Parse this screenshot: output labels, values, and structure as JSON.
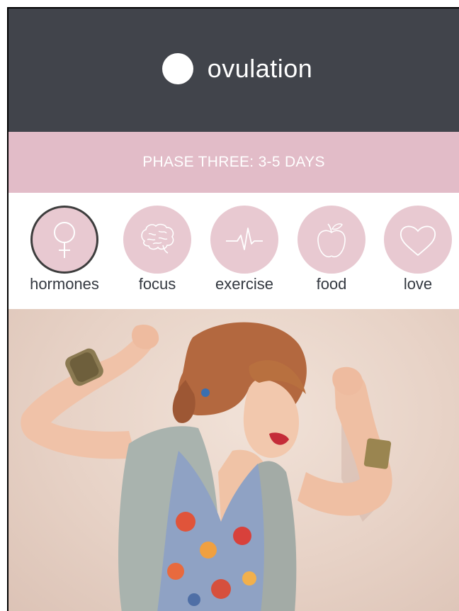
{
  "header": {
    "title": "ovulation",
    "accent": "#41444b"
  },
  "phase": {
    "label": "PHASE THREE: 3-5 DAYS",
    "color": "#e2bcc8"
  },
  "categories": [
    {
      "label": "hormones",
      "icon": "female-symbol-icon",
      "selected": true
    },
    {
      "label": "focus",
      "icon": "brain-icon",
      "selected": false
    },
    {
      "label": "exercise",
      "icon": "heartbeat-icon",
      "selected": false
    },
    {
      "label": "food",
      "icon": "apple-icon",
      "selected": false
    },
    {
      "label": "love",
      "icon": "heart-icon",
      "selected": false
    }
  ]
}
